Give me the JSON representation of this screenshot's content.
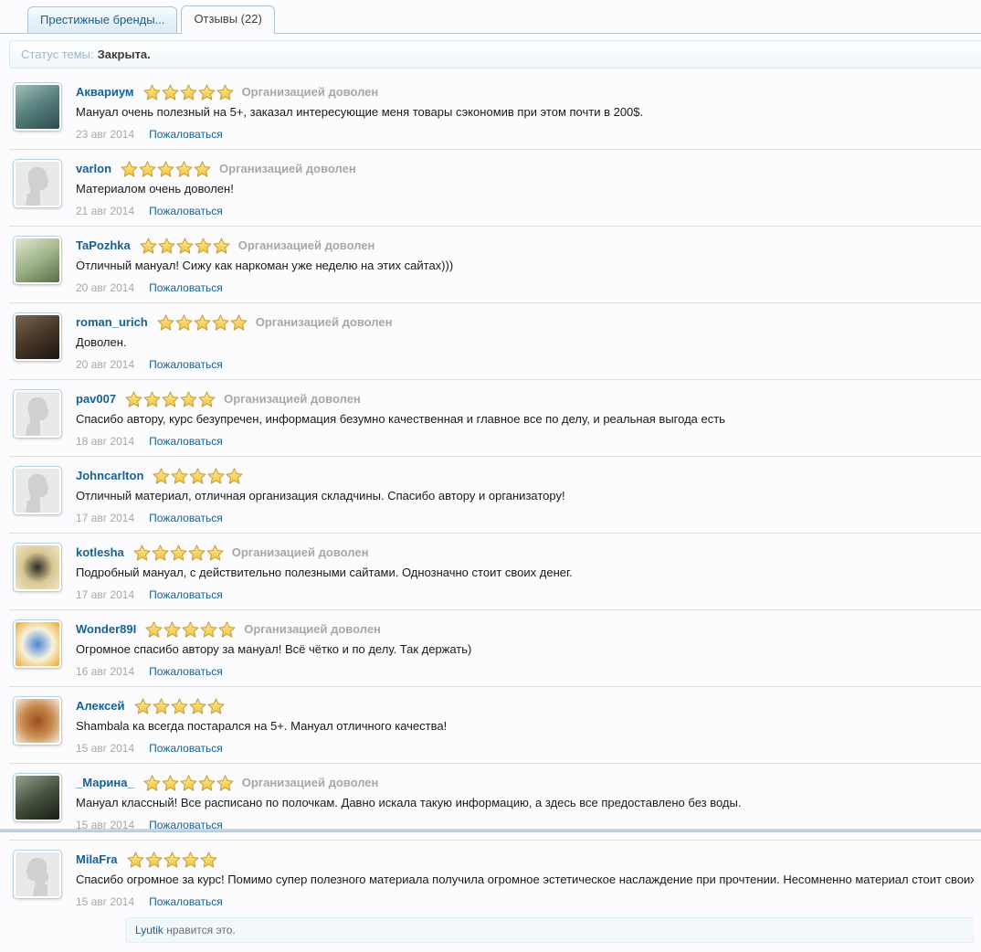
{
  "tabs": [
    {
      "label": "Престижные бренды...",
      "active": false
    },
    {
      "label": "Отзывы (22)",
      "active": true
    }
  ],
  "status_bar": {
    "label": "Статус темы:",
    "value": "Закрыта."
  },
  "strings": {
    "org_satisfied": "Организацией доволен",
    "report": "Пожаловаться"
  },
  "colors": {
    "link_blue": "#176093",
    "star_fill_top": "#fde99a",
    "star_fill_bottom": "#f2c43c",
    "star_stroke": "#c79b3b",
    "muted_gray": "#a7a7a7",
    "separator": "#d5e1ea",
    "silhouette_bg": "#e9e9e9",
    "silhouette_fg": "#d0d0d0"
  },
  "reviews": [
    {
      "username": "Аквариум",
      "rating": 5,
      "org_satisfied": true,
      "text": "Мануал очень полезный на 5+, заказал интересующие меня товары сэкономив при этом почти в 200$.",
      "date": "23 авг 2014",
      "avatar": {
        "kind": "photo",
        "shape": "linear",
        "colors": [
          "#9fc0ba",
          "#557e7c",
          "#2e4a4e"
        ]
      }
    },
    {
      "username": "varlon",
      "rating": 5,
      "org_satisfied": true,
      "text": "Материалом очень доволен!",
      "date": "21 авг 2014",
      "avatar": {
        "kind": "silhouette-male"
      }
    },
    {
      "username": "TaPozhka",
      "rating": 5,
      "org_satisfied": true,
      "text": "Отличный мануал! Сижу как наркоман уже неделю на этих сайтах)))",
      "date": "20 авг 2014",
      "avatar": {
        "kind": "photo",
        "shape": "linear",
        "colors": [
          "#e3e6d2",
          "#9fb489",
          "#5a6c48"
        ]
      }
    },
    {
      "username": "roman_urich",
      "rating": 5,
      "org_satisfied": true,
      "text": "Доволен.",
      "date": "20 авг 2014",
      "avatar": {
        "kind": "photo",
        "shape": "linear",
        "colors": [
          "#7a6550",
          "#463627",
          "#1c1610"
        ]
      }
    },
    {
      "username": "pav007",
      "rating": 5,
      "org_satisfied": true,
      "text": "Спасибо автору, курс безупречен, информация безумно качественная и главное все по делу, и реальная выгода есть",
      "date": "18 авг 2014",
      "avatar": {
        "kind": "silhouette-male"
      }
    },
    {
      "username": "Johncarlton",
      "rating": 5,
      "org_satisfied": false,
      "text": "Отличный материал, отличная организация складчины. Спасибо автору и организатору!",
      "date": "17 авг 2014",
      "avatar": {
        "kind": "silhouette-male"
      }
    },
    {
      "username": "kotlesha",
      "rating": 5,
      "org_satisfied": true,
      "text": "Подробный мануал, с действительно полезными сайтами. Однозначно стоит своих денег.",
      "date": "17 авг 2014",
      "avatar": {
        "kind": "photo",
        "shape": "radial",
        "colors": [
          "#2e2a24",
          "#d9c893",
          "#f0e6c4"
        ]
      }
    },
    {
      "username": "Wonder89I",
      "rating": 5,
      "org_satisfied": true,
      "text": "Огромное спасибо автору за мануал! Всё чётко и по делу. Так держать)",
      "date": "16 авг 2014",
      "avatar": {
        "kind": "photo",
        "shape": "radial",
        "colors": [
          "#4a86d8",
          "#f6f2dc",
          "#f0a830"
        ]
      }
    },
    {
      "username": "Алексей",
      "rating": 5,
      "org_satisfied": false,
      "text": "Shambala ка всегда постарался на 5+. Мануал отличного качества!",
      "date": "15 авг 2014",
      "avatar": {
        "kind": "photo",
        "shape": "radial",
        "colors": [
          "#9c4e20",
          "#c98b4e",
          "#f3ece2"
        ]
      }
    },
    {
      "username": "_Марина_",
      "rating": 5,
      "org_satisfied": true,
      "text": "Мануал классный! Все расписано по полочкам. Давно искала такую информацию, а здесь все предоставлено без воды.",
      "date": "15 авг 2014",
      "avatar": {
        "kind": "photo",
        "shape": "linear",
        "colors": [
          "#93a38c",
          "#45523f",
          "#171d14"
        ]
      }
    },
    {
      "username": "MilaFra",
      "rating": 5,
      "org_satisfied": false,
      "text": "Спасибо огромное за курс! Помимо супер полезного материала получила огромное эстетическое наслаждение при прочтении. Несомненно материал стоит своих денег!",
      "date": "15 авг 2014",
      "avatar": {
        "kind": "silhouette-female"
      },
      "likes": {
        "user": "Lyutik",
        "suffix": " нравится это."
      }
    }
  ]
}
